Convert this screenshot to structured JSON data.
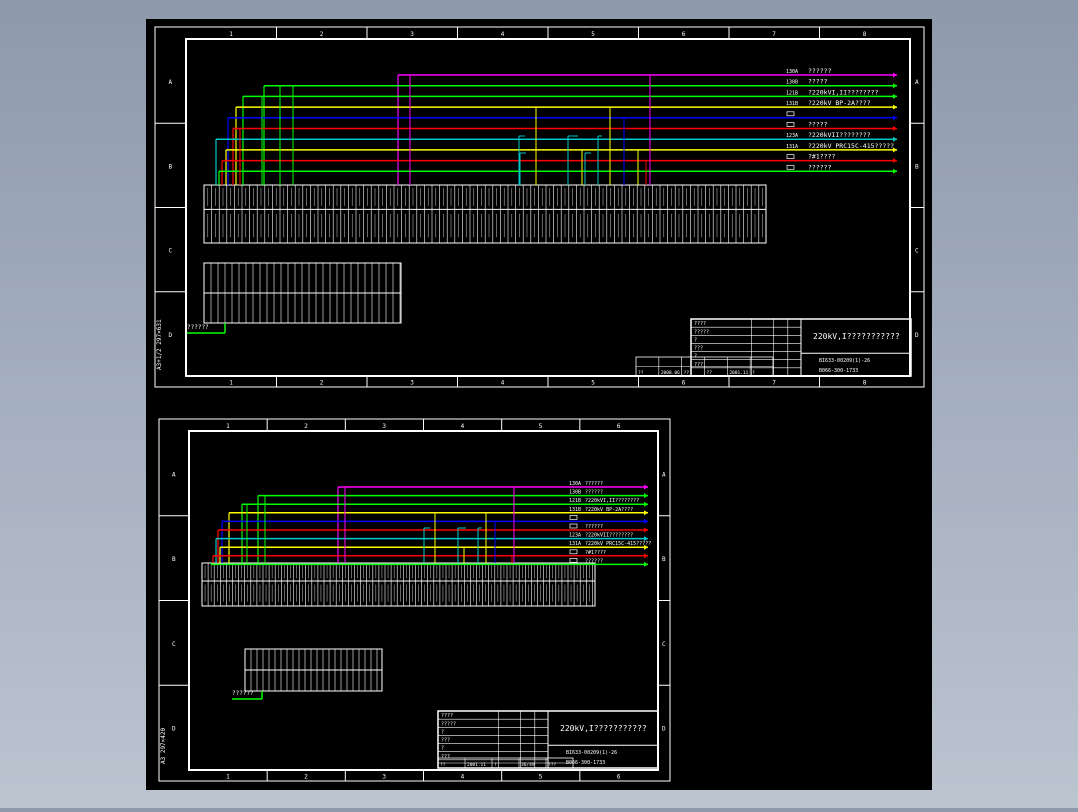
{
  "colors": {
    "background": "#8e99ab",
    "canvas": "#000000",
    "frame": "#ffffff",
    "magenta": "#ff00ff",
    "green": "#00ff00",
    "yellow": "#ffff00",
    "blue": "#0000ff",
    "red": "#ff0000",
    "cyan": "#00c8c8"
  },
  "sheet1": {
    "col_labels": [
      "1",
      "2",
      "3",
      "4",
      "5",
      "6",
      "7",
      "8"
    ],
    "row_labels": [
      "A",
      "B",
      "C",
      "D"
    ],
    "side_text": "A3+1/2 297×631",
    "legend": [
      {
        "code": "130A",
        "label": "??????",
        "color": "magenta"
      },
      {
        "code": "130B",
        "label": "?????",
        "color": "green"
      },
      {
        "code": "121B",
        "label": "?220kVI,II????????",
        "color": "green"
      },
      {
        "code": "131B",
        "label": "?220kV BP-2A????",
        "color": "yellow"
      },
      {
        "code": "",
        "label": "",
        "color": "blue"
      },
      {
        "code": "",
        "label": "?????",
        "color": "red"
      },
      {
        "code": "123A",
        "label": "?220kVII????????",
        "color": "cyan"
      },
      {
        "code": "131A",
        "label": "?220kV PRC15C-415?????",
        "color": "yellow"
      },
      {
        "code": "",
        "label": "?#1????",
        "color": "red"
      },
      {
        "code": "",
        "label": "??????",
        "color": "green"
      }
    ],
    "note": "??????",
    "title": "220kV,I???????????",
    "tb_rows": [
      "????",
      "?????",
      "?",
      "???",
      "?",
      "???"
    ],
    "tb_codes": [
      "BI633-00209(1)-26",
      "B066-300-1733"
    ],
    "tb_bottom": [
      "??",
      "2008.06",
      "??",
      "??",
      "2001.11",
      "?"
    ],
    "tb_sheet": ""
  },
  "sheet2": {
    "col_labels": [
      "1",
      "2",
      "3",
      "4",
      "5",
      "6"
    ],
    "row_labels": [
      "A",
      "B",
      "C",
      "D"
    ],
    "side_text": "A3 297×420",
    "legend": [
      {
        "code": "130A",
        "label": "??????",
        "color": "magenta"
      },
      {
        "code": "130B",
        "label": "??????",
        "color": "green"
      },
      {
        "code": "121B",
        "label": "?220kVI,II????????",
        "color": "green"
      },
      {
        "code": "131B",
        "label": "?220kV BP-2A????",
        "color": "yellow"
      },
      {
        "code": "",
        "label": "",
        "color": "blue"
      },
      {
        "code": "",
        "label": "??????",
        "color": "red"
      },
      {
        "code": "123A",
        "label": "?220kVII????????",
        "color": "cyan"
      },
      {
        "code": "131A",
        "label": "?220kV PRC15C-415?????",
        "color": "yellow"
      },
      {
        "code": "",
        "label": "?#1????",
        "color": "red"
      },
      {
        "code": "",
        "label": "??????",
        "color": "green"
      }
    ],
    "note": "??????",
    "title": "220kV,I???????????",
    "tb_rows": [
      "????",
      "?????",
      "?",
      "???",
      "?",
      "???"
    ],
    "tb_codes": [
      "BI633-00209(1)-26",
      "B066-300-1733"
    ],
    "tb_bottom": [
      "??",
      "2001.11",
      "?",
      "36/49",
      "???"
    ],
    "tb_sheet": "36/49"
  }
}
